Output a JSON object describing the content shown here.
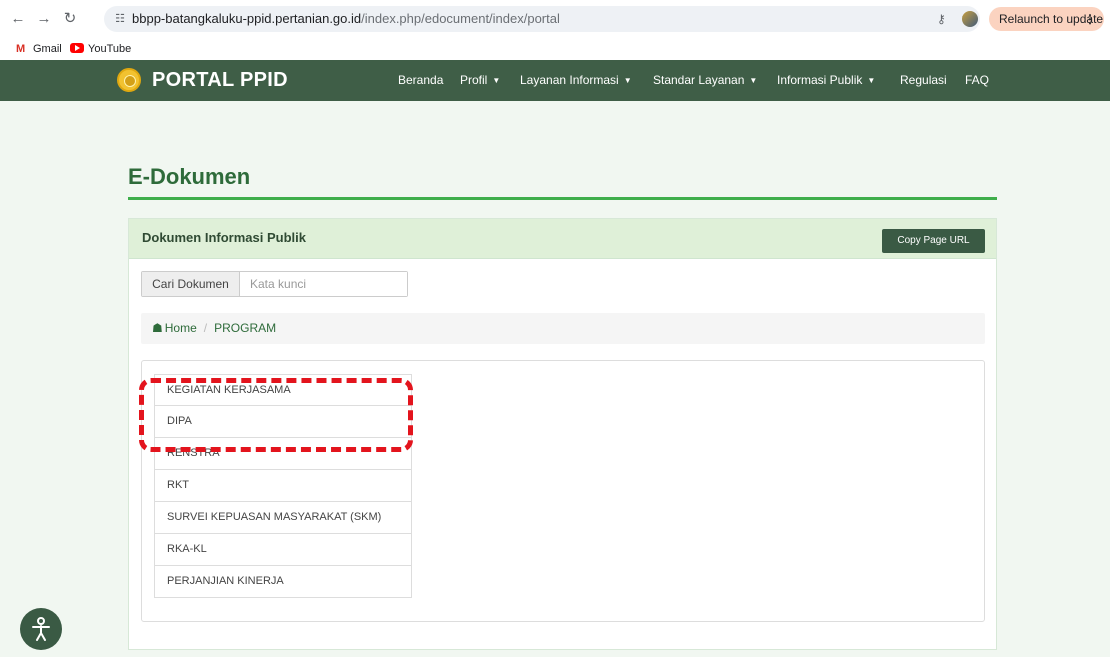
{
  "browser": {
    "url_host": "bbpp-batangkaluku-ppid.pertanian.go.id",
    "url_path": "/index.php/edocument/index/portal",
    "relaunch_label": "Relaunch to update",
    "bookmarks": [
      {
        "label": "Gmail",
        "icon": "gmail-icon"
      },
      {
        "label": "YouTube",
        "icon": "youtube-icon"
      }
    ]
  },
  "site_nav": {
    "brand": "PORTAL PPID",
    "menu": [
      {
        "label": "Beranda",
        "dropdown": false
      },
      {
        "label": "Profil",
        "dropdown": true
      },
      {
        "label": "Layanan Informasi",
        "dropdown": true
      },
      {
        "label": "Standar Layanan",
        "dropdown": true
      },
      {
        "label": "Informasi Publik",
        "dropdown": true
      },
      {
        "label": "Regulasi",
        "dropdown": false
      },
      {
        "label": "FAQ",
        "dropdown": false
      }
    ]
  },
  "page": {
    "title": "E-Dokumen",
    "panel_title": "Dokumen Informasi Publik",
    "copy_button": "Copy Page URL",
    "search": {
      "addon_label": "Cari Dokumen",
      "placeholder": "Kata kunci"
    },
    "breadcrumb": {
      "home": "Home",
      "current": "PROGRAM"
    },
    "documents": [
      "KEGIATAN KERJASAMA",
      "DIPA",
      "RENSTRA",
      "RKT",
      "SURVEI KEPUASAN MASYARAKAT (SKM)",
      "RKA-KL",
      "PERJANJIAN KINERJA"
    ]
  },
  "colors": {
    "nav_bg": "#3f5e47",
    "accent_green": "#2e6b3a",
    "highlight": "#e3141d"
  }
}
